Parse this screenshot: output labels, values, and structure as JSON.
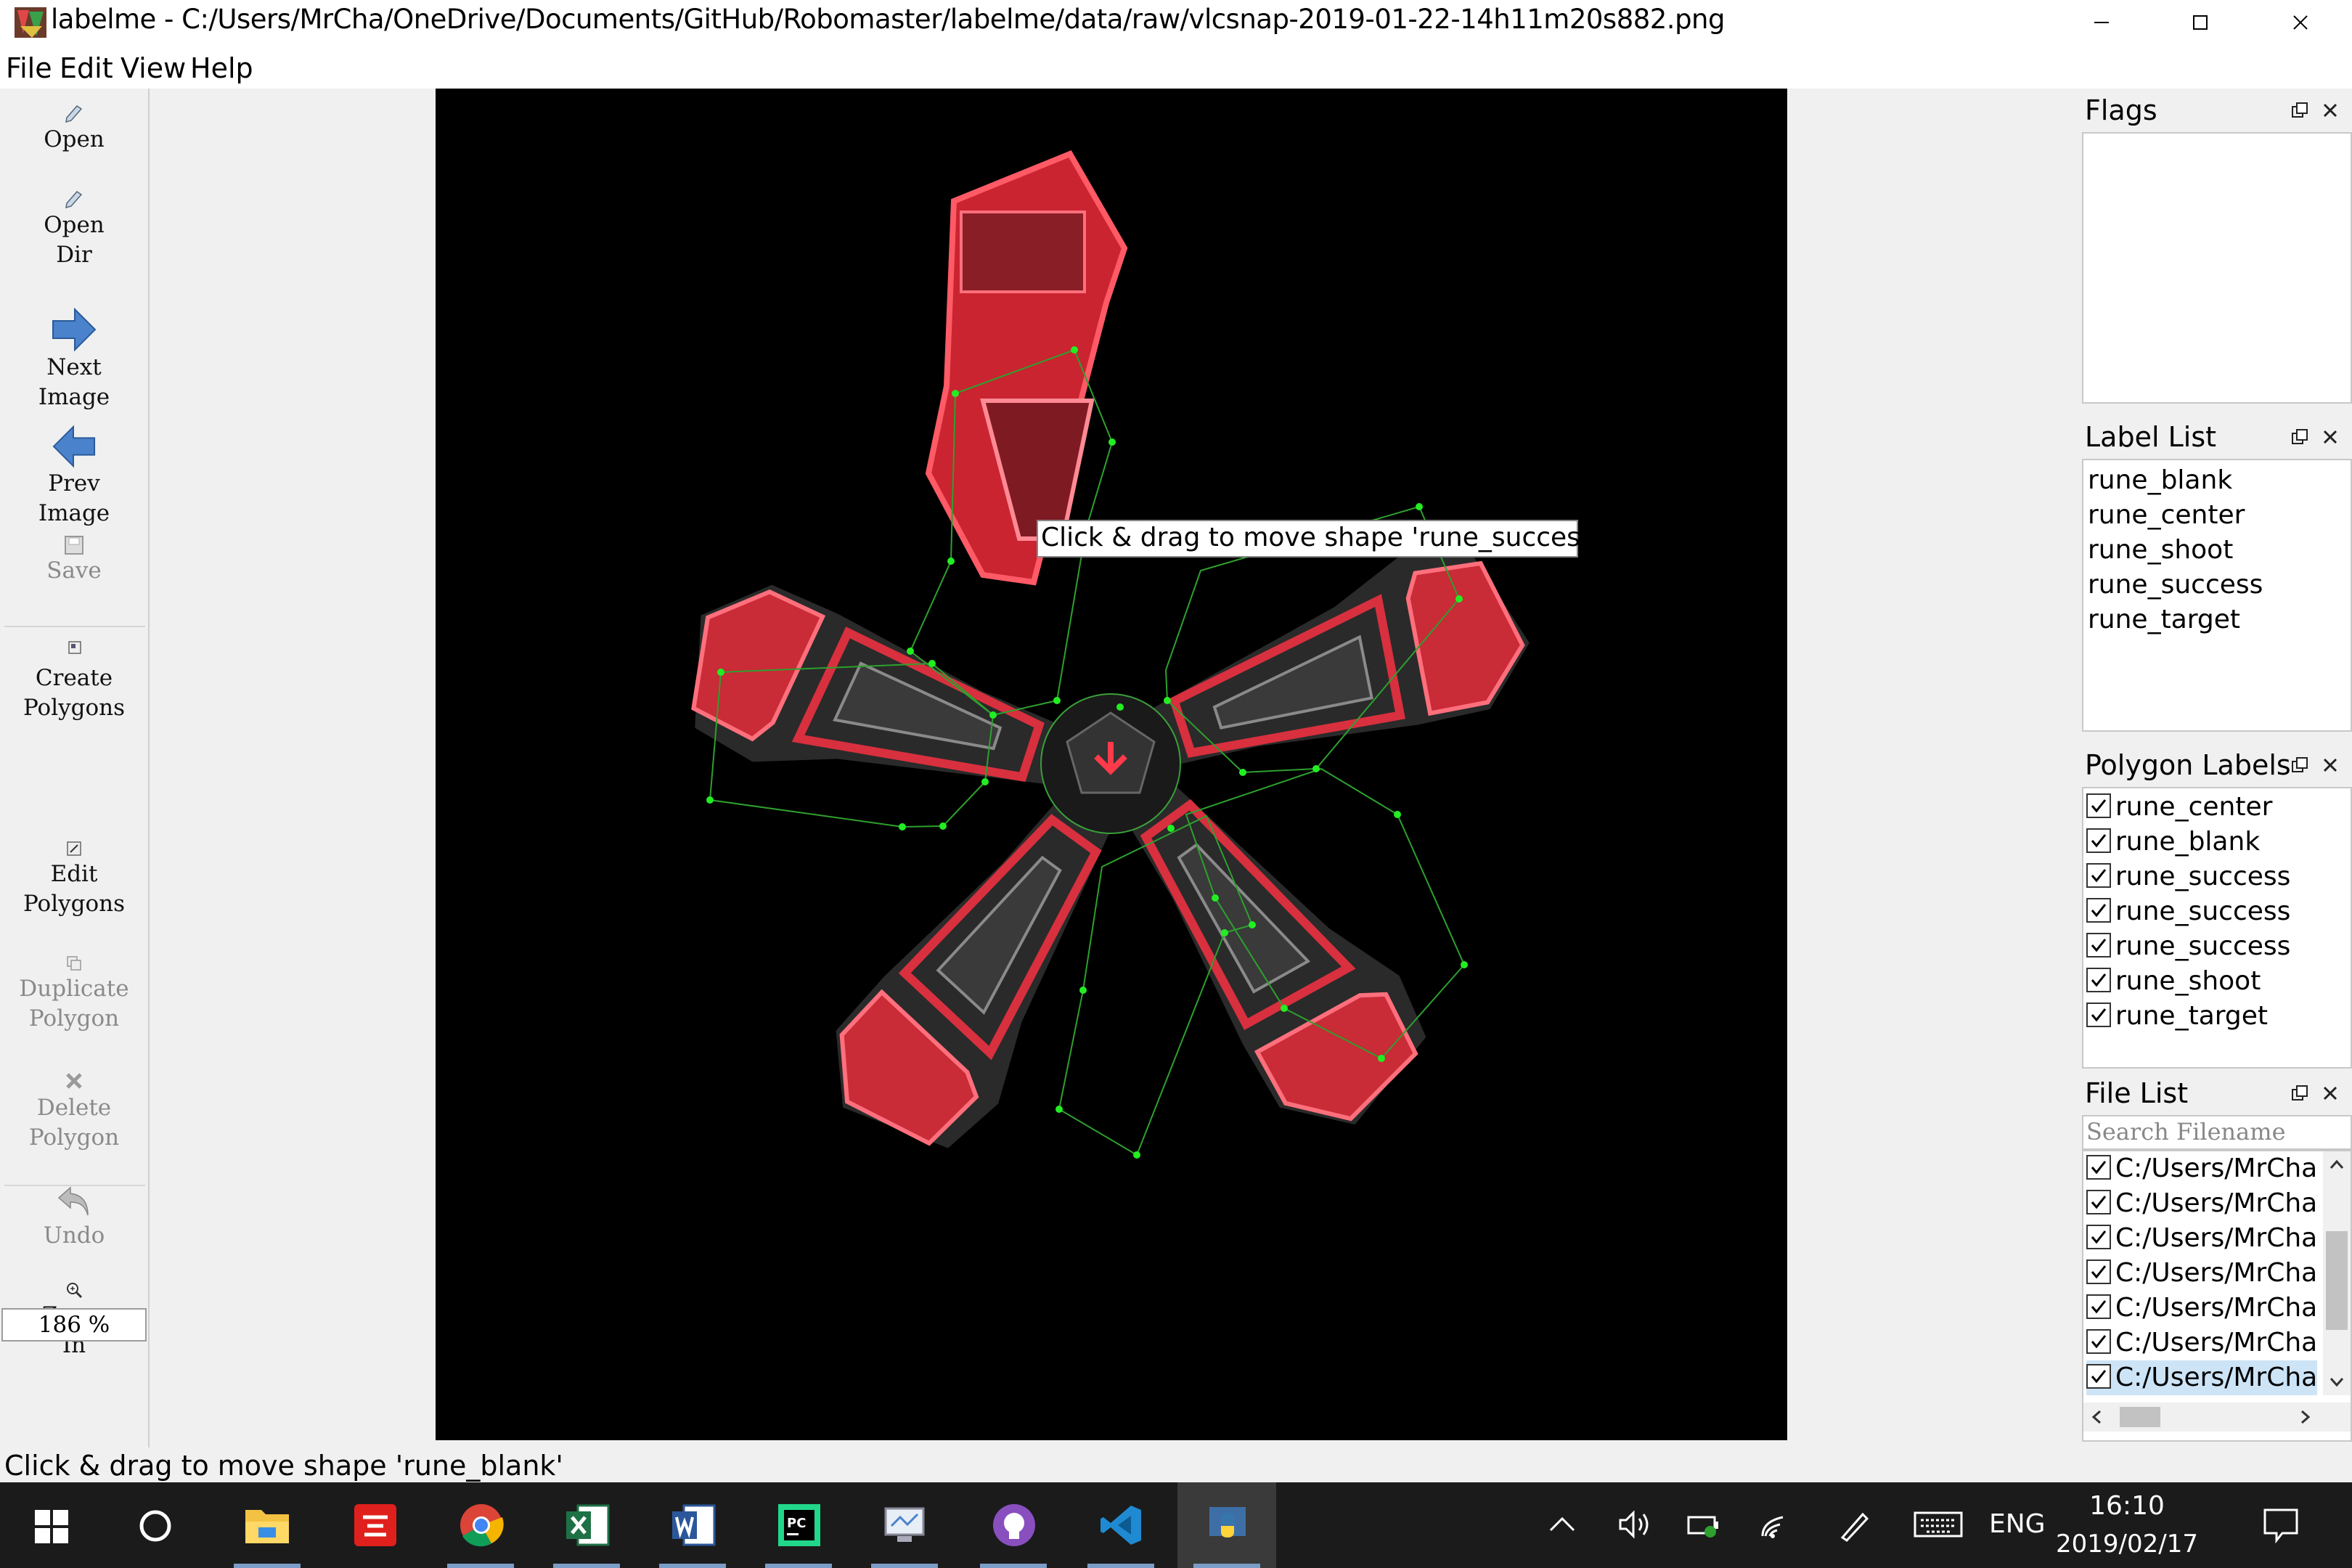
{
  "window": {
    "title": "labelme - C:/Users/MrCha/OneDrive/Documents/GitHub/Robomaster/labelme/data/raw/vlcsnap-2019-01-22-14h11m20s882.png",
    "controls": [
      "minimize",
      "maximize",
      "close"
    ]
  },
  "menu": [
    "File",
    "Edit",
    "View",
    "Help"
  ],
  "toolbar": {
    "open": "Open",
    "open_dir_1": "Open",
    "open_dir_2": "Dir",
    "next_1": "Next",
    "next_2": "Image",
    "prev_1": "Prev",
    "prev_2": "Image",
    "save": "Save",
    "create_1": "Create",
    "create_2": "Polygons",
    "edit_1": "Edit",
    "edit_2": "Polygons",
    "dup_1": "Duplicate",
    "dup_2": "Polygon",
    "del_1": "Delete",
    "del_2": "Polygon",
    "undo": "Undo",
    "zoom_1": "Zoom",
    "zoom_2": "In",
    "zoom_value": "186 %"
  },
  "canvas": {
    "tooltip": "Click & drag to move shape 'rune_success'"
  },
  "docks": {
    "flags": {
      "title": "Flags"
    },
    "label_list": {
      "title": "Label List",
      "items": [
        "rune_blank",
        "rune_center",
        "rune_shoot",
        "rune_success",
        "rune_target"
      ]
    },
    "polygon_labels": {
      "title": "Polygon Labels",
      "items": [
        "rune_center",
        "rune_blank",
        "rune_success",
        "rune_success",
        "rune_success",
        "rune_shoot",
        "rune_target"
      ]
    },
    "file_list": {
      "title": "File List",
      "search_placeholder": "Search Filename",
      "items": [
        "C:/Users/MrCha",
        "C:/Users/MrCha",
        "C:/Users/MrCha",
        "C:/Users/MrCha",
        "C:/Users/MrCha",
        "C:/Users/MrCha",
        "C:/Users/MrCha"
      ]
    }
  },
  "status": "Click & drag to move shape 'rune_blank'",
  "taskbar": {
    "apps": [
      "start-icon",
      "cortana-icon",
      "file-explorer-icon",
      "youdao-icon",
      "chrome-icon",
      "excel-icon",
      "word-icon",
      "pycharm-icon",
      "remote-icon",
      "github-icon",
      "vscode-icon",
      "python-icon"
    ],
    "language": "ENG",
    "time": "16:10",
    "date": "2019/02/17"
  },
  "colors": {
    "shape_outline": "#2ea02e",
    "vertex": "#22ee22",
    "rune_red": "#e0303c"
  }
}
